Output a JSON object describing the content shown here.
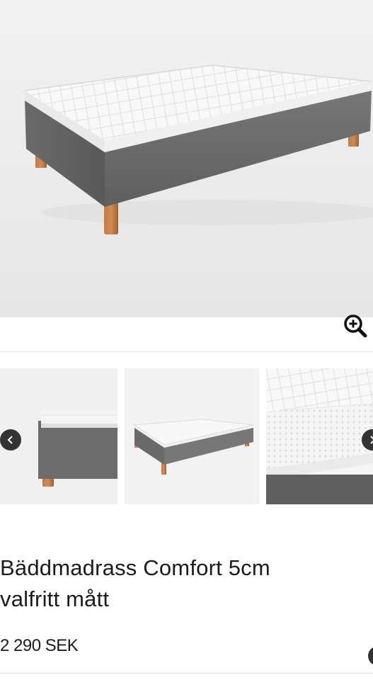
{
  "product": {
    "title_line1": "Bäddmadrass Comfort 5cm",
    "title_line2": "valfritt mått",
    "price": "2 290 SEK"
  },
  "gallery": {
    "main_image": "bed-with-mattress-topper",
    "zoom_icon": "zoom-in-icon",
    "thumbnails": [
      "bed-corner-closeup",
      "bed-full-view",
      "mattress-topper-quilted-detail"
    ],
    "prev_icon": "chevron-left-icon",
    "next_icon": "chevron-right-icon"
  },
  "colors": {
    "fabric_gray": "#6e6e6e",
    "topper_white": "#f7f7f7",
    "wood_leg": "#b86e3c",
    "arrow_bg": "#333333"
  }
}
